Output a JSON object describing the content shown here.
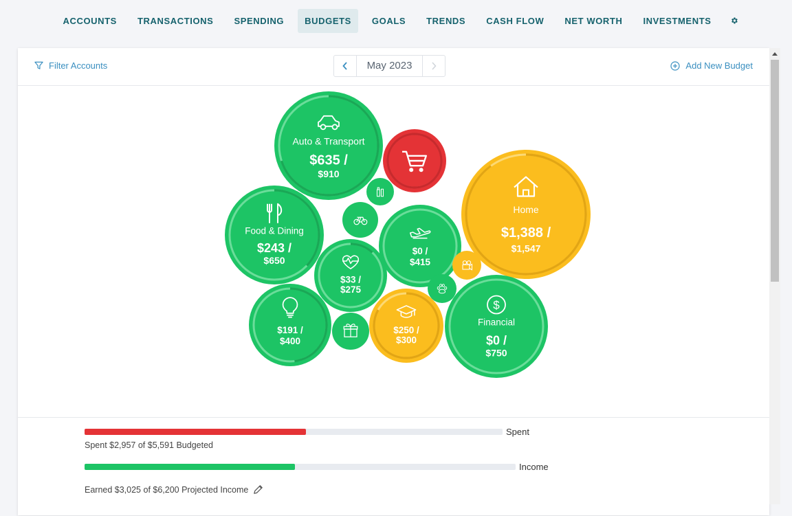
{
  "nav": {
    "items": [
      {
        "label": "ACCOUNTS",
        "active": false
      },
      {
        "label": "TRANSACTIONS",
        "active": false
      },
      {
        "label": "SPENDING",
        "active": false
      },
      {
        "label": "BUDGETS",
        "active": true
      },
      {
        "label": "GOALS",
        "active": false
      },
      {
        "label": "TRENDS",
        "active": false
      },
      {
        "label": "CASH FLOW",
        "active": false
      },
      {
        "label": "NET WORTH",
        "active": false
      },
      {
        "label": "INVESTMENTS",
        "active": false
      }
    ],
    "settings_icon": "gear-icon"
  },
  "toolbar": {
    "filter_label": "Filter Accounts",
    "month": "May 2023",
    "add_label": "Add New Budget"
  },
  "colors": {
    "accent": "#16626d",
    "link": "#3a8fc0",
    "green": "#1dc465",
    "red": "#e43336",
    "yellow": "#fbbd1e"
  },
  "bubbles": [
    {
      "id": "auto",
      "icon": "car-icon",
      "label": "Auto & Transport",
      "spent": "$635 /",
      "budget": "$910",
      "status": "green",
      "progress": 0.7
    },
    {
      "id": "shopping",
      "icon": "shopping-cart-icon",
      "label": "",
      "spent": "",
      "budget": "",
      "status": "red",
      "progress": 1.0
    },
    {
      "id": "personal",
      "icon": "personal-care-icon",
      "label": "",
      "spent": "",
      "budget": "",
      "status": "green",
      "progress": 0
    },
    {
      "id": "home",
      "icon": "house-icon",
      "label": "Home",
      "spent": "$1,388 /",
      "budget": "$1,547",
      "status": "yellow",
      "progress": 0.9
    },
    {
      "id": "food",
      "icon": "utensils-icon",
      "label": "Food & Dining",
      "spent": "$243 /",
      "budget": "$650",
      "status": "green",
      "progress": 0.37
    },
    {
      "id": "bike",
      "icon": "bicycle-icon",
      "label": "",
      "spent": "",
      "budget": "",
      "status": "green",
      "progress": 0
    },
    {
      "id": "travel",
      "icon": "airplane-icon",
      "label": "",
      "spent": "$0 /",
      "budget": "$415",
      "status": "green",
      "progress": 0
    },
    {
      "id": "health",
      "icon": "heartbeat-icon",
      "label": "",
      "spent": "$33 /",
      "budget": "$275",
      "status": "green",
      "progress": 0.12
    },
    {
      "id": "entertainment",
      "icon": "movie-camera-icon",
      "label": "",
      "spent": "",
      "budget": "",
      "status": "yellow",
      "progress": 0
    },
    {
      "id": "pets",
      "icon": "paw-icon",
      "label": "",
      "spent": "",
      "budget": "",
      "status": "green",
      "progress": 0
    },
    {
      "id": "bills",
      "icon": "lightbulb-icon",
      "label": "",
      "spent": "$191 /",
      "budget": "$400",
      "status": "green",
      "progress": 0.48
    },
    {
      "id": "gifts",
      "icon": "gift-icon",
      "label": "",
      "spent": "",
      "budget": "",
      "status": "green",
      "progress": 0
    },
    {
      "id": "education",
      "icon": "graduation-cap-icon",
      "label": "",
      "spent": "$250 /",
      "budget": "$300",
      "status": "yellow",
      "progress": 0.83
    },
    {
      "id": "financial",
      "icon": "dollar-circle-icon",
      "label": "Financial",
      "spent": "$0 /",
      "budget": "$750",
      "status": "green",
      "progress": 0
    }
  ],
  "summary": {
    "spent": {
      "label": "Spent",
      "caption": "Spent $2,957 of $5,591 Budgeted",
      "fraction": 0.529
    },
    "income": {
      "label": "Income",
      "caption": "Earned $3,025 of $6,200 Projected Income",
      "fraction": 0.488,
      "edit_icon": "pencil-icon"
    }
  }
}
